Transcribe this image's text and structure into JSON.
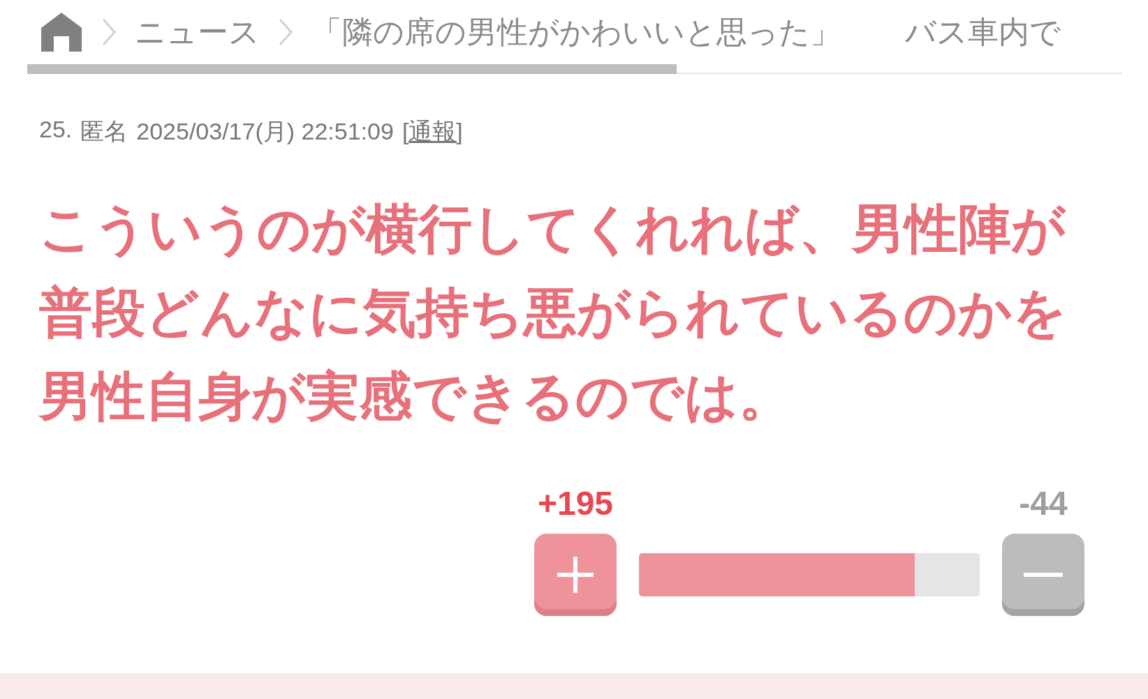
{
  "breadcrumb": [
    "ニュース",
    "「隣の席の男性がかわいいと思った」",
    "バス車内で"
  ],
  "comment": {
    "number": "25.",
    "name": "匿名",
    "datetime": "2025/03/17(月) 22:51:09",
    "report": "[通報]",
    "body": "こういうのが横行してくれれば、男性陣が普段どんなに気持ち悪がられているのかを男性自身が実感できるのでは。"
  },
  "vote": {
    "plus": "+195",
    "minus": "-44",
    "level": 0.81
  }
}
